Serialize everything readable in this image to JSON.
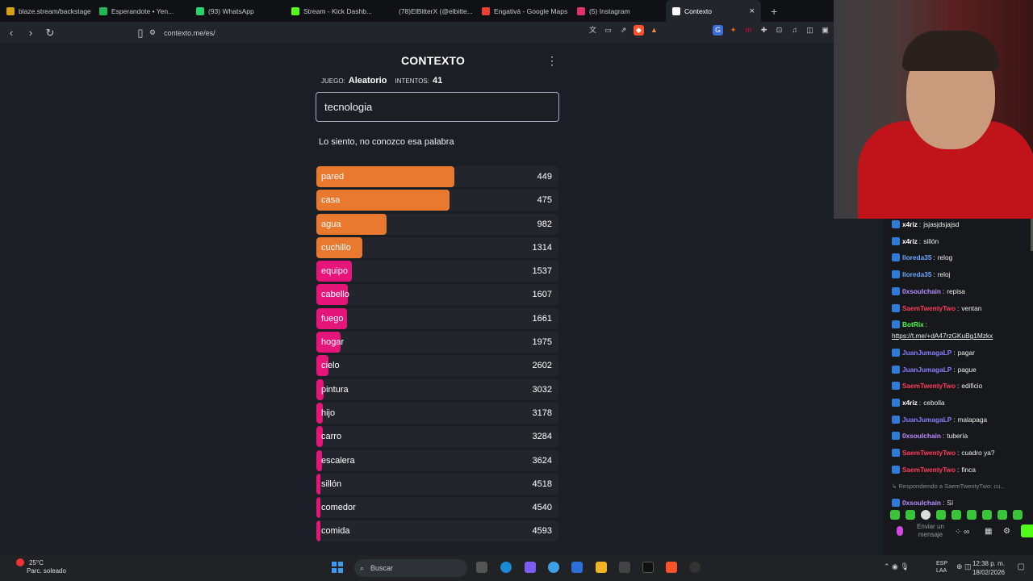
{
  "browser": {
    "tabs": [
      {
        "label": "blaze.stream/backstage",
        "icon": "blaze-icon",
        "color": "#d4a017"
      },
      {
        "label": "Esperandote • Yen...",
        "icon": "spotify-icon",
        "color": "#1db954"
      },
      {
        "label": "(93) WhatsApp",
        "icon": "whatsapp-icon",
        "color": "#25d366"
      },
      {
        "label": "Stream - Kick Dashb...",
        "icon": "kick-icon",
        "color": "#53fc18"
      },
      {
        "label": "(78)ElBitterX (@elbitte...",
        "icon": "tiktok-icon",
        "color": "#111111"
      },
      {
        "label": "Engativá - Google Maps",
        "icon": "maps-icon",
        "color": "#ea4335"
      },
      {
        "label": "(5) Instagram",
        "icon": "instagram-icon",
        "color": "#e1306c"
      },
      {
        "label": "Contexto",
        "icon": "contexto-icon",
        "color": "#ffffff",
        "active": true
      }
    ],
    "url": "contexto.me/es/"
  },
  "game": {
    "title": "CONTEXTO",
    "game_label": "JUEGO:",
    "game_value": "Aleatorio",
    "attempts_label": "INTENTOS:",
    "attempts_value": "41",
    "input_value": "tecnologia",
    "message": "Lo siento, no conozco esa palabra",
    "colors": {
      "orange": "#e8792f",
      "pink": "#e5157a"
    },
    "guesses": [
      {
        "word": "pared",
        "rank": "449",
        "fill": 0.57,
        "color": "#e8792f"
      },
      {
        "word": "casa",
        "rank": "475",
        "fill": 0.55,
        "color": "#e8792f"
      },
      {
        "word": "agua",
        "rank": "982",
        "fill": 0.29,
        "color": "#e8792f"
      },
      {
        "word": "cuchillo",
        "rank": "1314",
        "fill": 0.19,
        "color": "#e8792f"
      },
      {
        "word": "equipo",
        "rank": "1537",
        "fill": 0.145,
        "color": "#e5157a"
      },
      {
        "word": "cabello",
        "rank": "1607",
        "fill": 0.13,
        "color": "#e5157a"
      },
      {
        "word": "fuego",
        "rank": "1661",
        "fill": 0.125,
        "color": "#e5157a"
      },
      {
        "word": "hogar",
        "rank": "1975",
        "fill": 0.1,
        "color": "#e5157a"
      },
      {
        "word": "cielo",
        "rank": "2602",
        "fill": 0.05,
        "color": "#e5157a"
      },
      {
        "word": "pintura",
        "rank": "3032",
        "fill": 0.03,
        "color": "#e5157a"
      },
      {
        "word": "hijo",
        "rank": "3178",
        "fill": 0.028,
        "color": "#e5157a"
      },
      {
        "word": "carro",
        "rank": "3284",
        "fill": 0.026,
        "color": "#e5157a"
      },
      {
        "word": "escalera",
        "rank": "3624",
        "fill": 0.022,
        "color": "#e5157a"
      },
      {
        "word": "sillón",
        "rank": "4518",
        "fill": 0.018,
        "color": "#e5157a"
      },
      {
        "word": "comedor",
        "rank": "4540",
        "fill": 0.018,
        "color": "#e5157a"
      },
      {
        "word": "comida",
        "rank": "4593",
        "fill": 0.017,
        "color": "#e5157a"
      }
    ]
  },
  "chat": {
    "messages": [
      {
        "user": "x4riz",
        "text": "jsjasjdsjajsd",
        "color": "#ffffff"
      },
      {
        "user": "x4riz",
        "text": "sillón",
        "color": "#ffffff"
      },
      {
        "user": "lloreda35",
        "text": "relog",
        "color": "#6aa7ff"
      },
      {
        "user": "lloreda35",
        "text": "reloj",
        "color": "#6aa7ff"
      },
      {
        "user": "0xsoulchain",
        "text": "repisa",
        "color": "#b98cff"
      },
      {
        "user": "SaemTwentyTwo",
        "text": "ventan",
        "color": "#ff3b5c"
      },
      {
        "user": "BotRix",
        "text": "",
        "color": "#4cff4c"
      },
      {
        "user": "",
        "text": "https://t.me/+dA47rzGKuBg1Mzkx",
        "color": "#ffffff",
        "link": true
      },
      {
        "user": "JuanJumagaLP",
        "text": "pagar",
        "color": "#8a7dff"
      },
      {
        "user": "JuanJumagaLP",
        "text": "pague",
        "color": "#8a7dff"
      },
      {
        "user": "SaemTwentyTwo",
        "text": "edificio",
        "color": "#ff3b5c"
      },
      {
        "user": "x4riz",
        "text": "cebolla",
        "color": "#ffffff"
      },
      {
        "user": "JuanJumagaLP",
        "text": "malapaga",
        "color": "#8a7dff"
      },
      {
        "user": "0xsoulchain",
        "text": "tubería",
        "color": "#b98cff"
      },
      {
        "user": "SaemTwentyTwo",
        "text": "cuadro ya?",
        "color": "#ff3b5c"
      },
      {
        "user": "SaemTwentyTwo",
        "text": "finca",
        "color": "#ff3b5c"
      },
      {
        "user": "",
        "text": "↳ Respondiendo a SaemTwentyTwo: cu...",
        "color": "#888888",
        "reply": true
      },
      {
        "user": "0xsoulchain",
        "text": "Sí",
        "color": "#b98cff"
      }
    ],
    "send_placeholder": "Enviar un mensaje"
  },
  "taskbar": {
    "temp": "25°C",
    "weather": "Parc. soleado",
    "search": "Buscar",
    "lang1": "ESP",
    "lang2": "LAA",
    "time": "12:38 p. m.",
    "date": "18/02/2026"
  }
}
